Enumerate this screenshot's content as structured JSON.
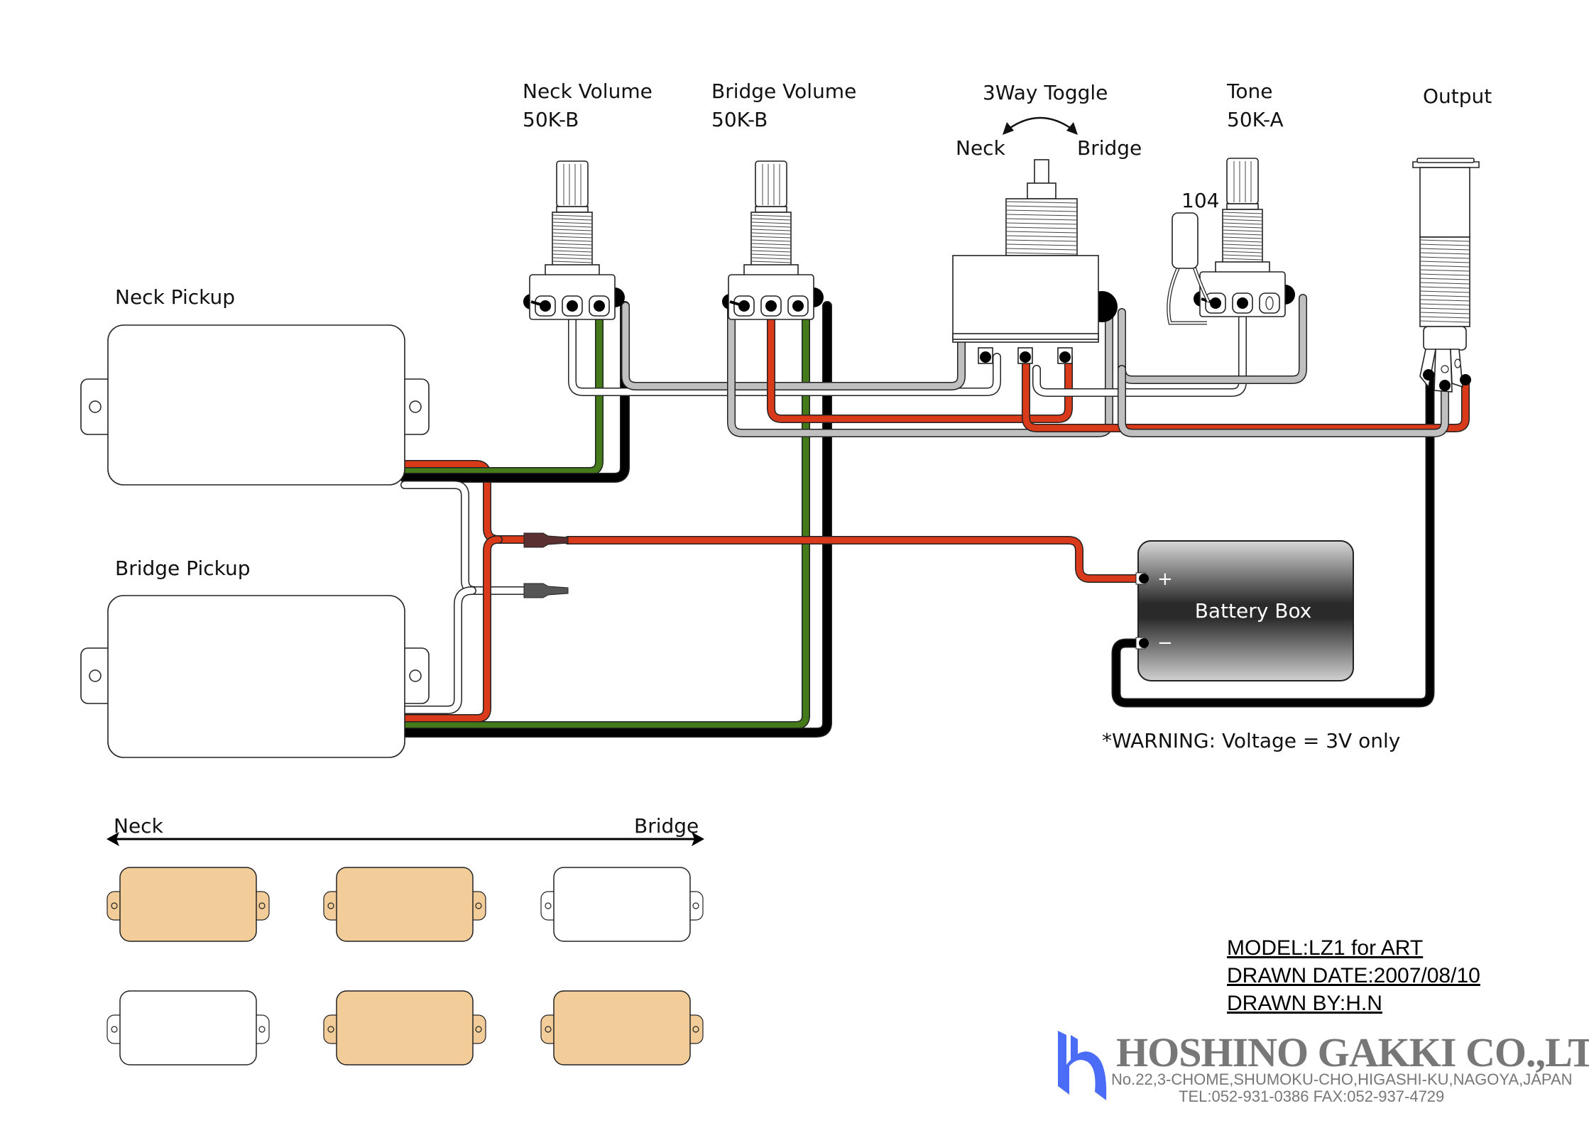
{
  "labels": {
    "neck_volume": "Neck Volume",
    "neck_volume_value": "50K-B",
    "bridge_volume": "Bridge Volume",
    "bridge_volume_value": "50K-B",
    "toggle": "3Way Toggle",
    "toggle_neck": "Neck",
    "toggle_bridge": "Bridge",
    "tone": "Tone",
    "tone_value": "50K-A",
    "capacitor": "104",
    "output": "Output",
    "neck_pickup": "Neck Pickup",
    "bridge_pickup": "Bridge Pickup",
    "battery_box": "Battery Box",
    "battery_plus": "+",
    "battery_minus": "−",
    "warning": "*WARNING: Voltage = 3V only",
    "position_neck": "Neck",
    "position_bridge": "Bridge"
  },
  "pickup_selector_grid": {
    "rows": [
      [
        {
          "active": true
        },
        {
          "active": true
        },
        {
          "active": false
        }
      ],
      [
        {
          "active": false
        },
        {
          "active": true
        },
        {
          "active": true
        }
      ]
    ],
    "active_color": "#f2cd9a",
    "inactive_color": "#ffffff"
  },
  "wire_colors": {
    "red": "#d93a1a",
    "green": "#447a1a",
    "black": "#000000",
    "white": "#ffffff",
    "gray": "#c0c0c0"
  },
  "title_block": {
    "model": "MODEL:LZ1 for  ART",
    "drawn_date": "DRAWN DATE:2007/08/10",
    "drawn_by": "DRAWN BY:H.N"
  },
  "company": {
    "name": "HOSHINO GAKKI CO.,LTD.",
    "address": "No.22,3-CHOME,SHUMOKU-CHO,HIGASHI-KU,NAGOYA,JAPAN",
    "contact": "TEL:052-931-0386  FAX:052-937-4729",
    "logo_color": "#4a6cf7"
  }
}
